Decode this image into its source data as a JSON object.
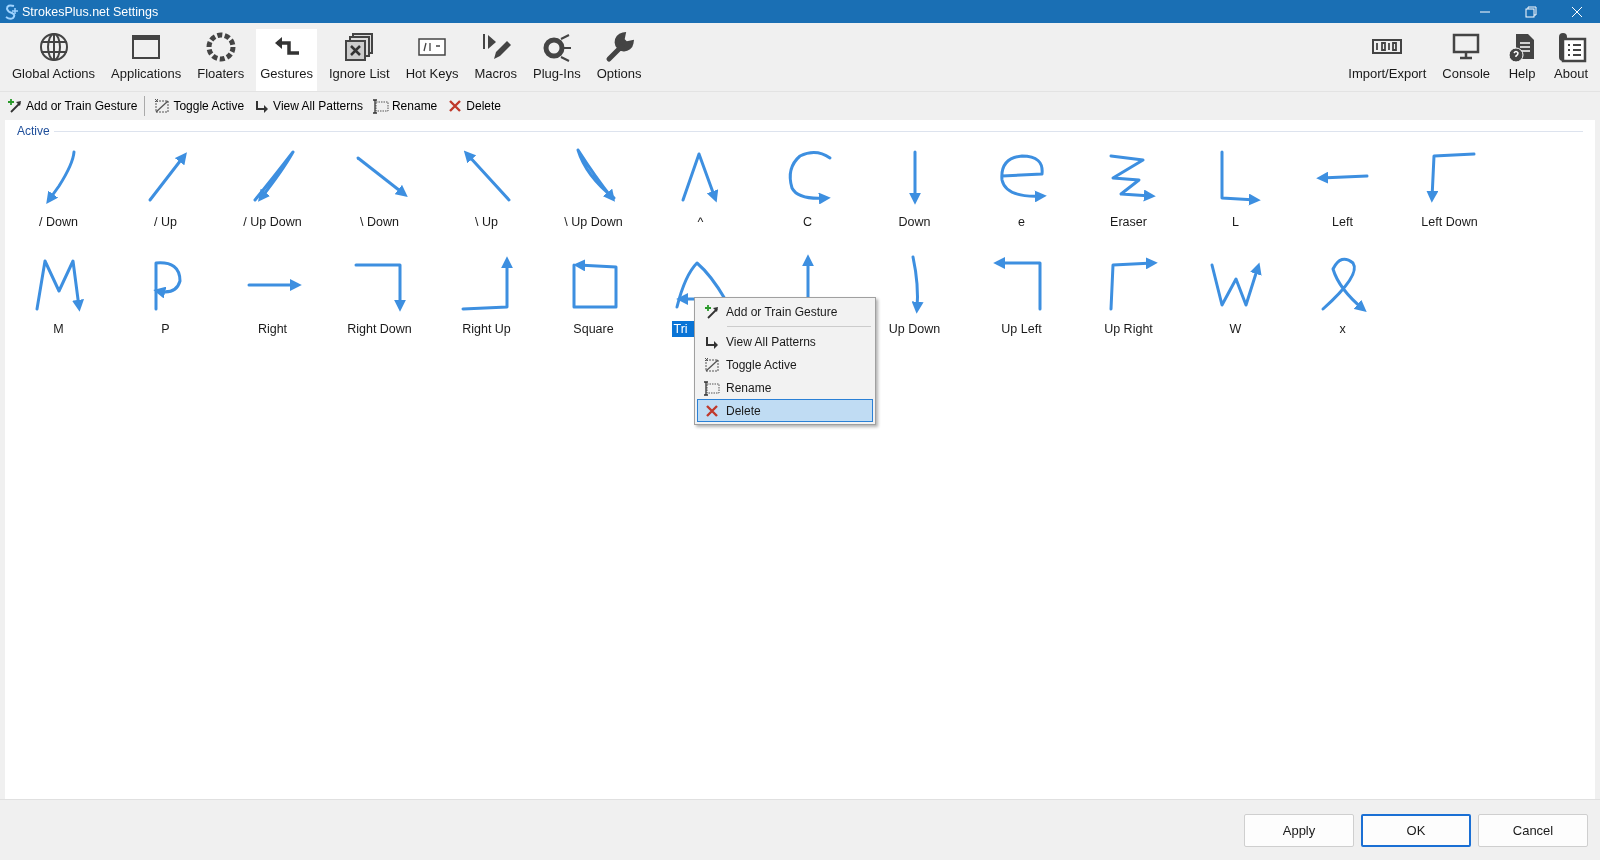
{
  "window": {
    "title": "StrokesPlus.net Settings"
  },
  "toolbar": {
    "items": [
      {
        "label": "Global Actions",
        "selected": false
      },
      {
        "label": "Applications",
        "selected": false
      },
      {
        "label": "Floaters",
        "selected": false
      },
      {
        "label": "Gestures",
        "selected": true
      },
      {
        "label": "Ignore List",
        "selected": false
      },
      {
        "label": "Hot Keys",
        "selected": false
      },
      {
        "label": "Macros",
        "selected": false
      },
      {
        "label": "Plug-Ins",
        "selected": false
      },
      {
        "label": "Options",
        "selected": false
      }
    ],
    "right_items": [
      {
        "label": "Import/Export",
        "selected": false
      },
      {
        "label": "Console",
        "selected": false
      },
      {
        "label": "Help",
        "selected": false
      },
      {
        "label": "About",
        "selected": false
      }
    ]
  },
  "actions": [
    "Add or Train Gesture",
    "Toggle Active",
    "View All Patterns",
    "Rename",
    "Delete"
  ],
  "group": {
    "title": "Active"
  },
  "gestures": [
    {
      "label": "/ Down",
      "selected": false
    },
    {
      "label": "/ Up",
      "selected": false
    },
    {
      "label": "/ Up Down",
      "selected": false
    },
    {
      "label": "\\ Down",
      "selected": false
    },
    {
      "label": "\\ Up",
      "selected": false
    },
    {
      "label": "\\ Up Down",
      "selected": false
    },
    {
      "label": "^",
      "selected": false
    },
    {
      "label": "C",
      "selected": false
    },
    {
      "label": "Down",
      "selected": false
    },
    {
      "label": "e",
      "selected": false
    },
    {
      "label": "Eraser",
      "selected": false
    },
    {
      "label": "L",
      "selected": false
    },
    {
      "label": "Left",
      "selected": false
    },
    {
      "label": "Left Down",
      "selected": false
    },
    {
      "label": "M",
      "selected": false
    },
    {
      "label": "P",
      "selected": false
    },
    {
      "label": "Right",
      "selected": false
    },
    {
      "label": "Right Down",
      "selected": false
    },
    {
      "label": "Right Up",
      "selected": false
    },
    {
      "label": "Square",
      "selected": false
    },
    {
      "label": "Tri",
      "selected": true
    },
    {
      "selected": false
    },
    {
      "label": "Up Down",
      "selected": false
    },
    {
      "label": "Up Left",
      "selected": false
    },
    {
      "label": "Up Right",
      "selected": false
    },
    {
      "label": "W",
      "selected": false
    },
    {
      "label": "x",
      "selected": false
    }
  ],
  "context_menu": {
    "items": [
      {
        "kind": "item",
        "label": "Add or Train Gesture",
        "selected": false
      },
      {
        "kind": "separator"
      },
      {
        "kind": "item",
        "label": "View All Patterns",
        "selected": false
      },
      {
        "kind": "item",
        "label": "Toggle Active",
        "selected": false
      },
      {
        "kind": "item",
        "label": "Rename",
        "selected": false
      },
      {
        "kind": "item",
        "label": "Delete",
        "selected": true
      }
    ]
  },
  "buttons": [
    {
      "label": "Apply",
      "default": false
    },
    {
      "label": "OK",
      "default": true
    },
    {
      "label": "Cancel",
      "default": false
    }
  ]
}
